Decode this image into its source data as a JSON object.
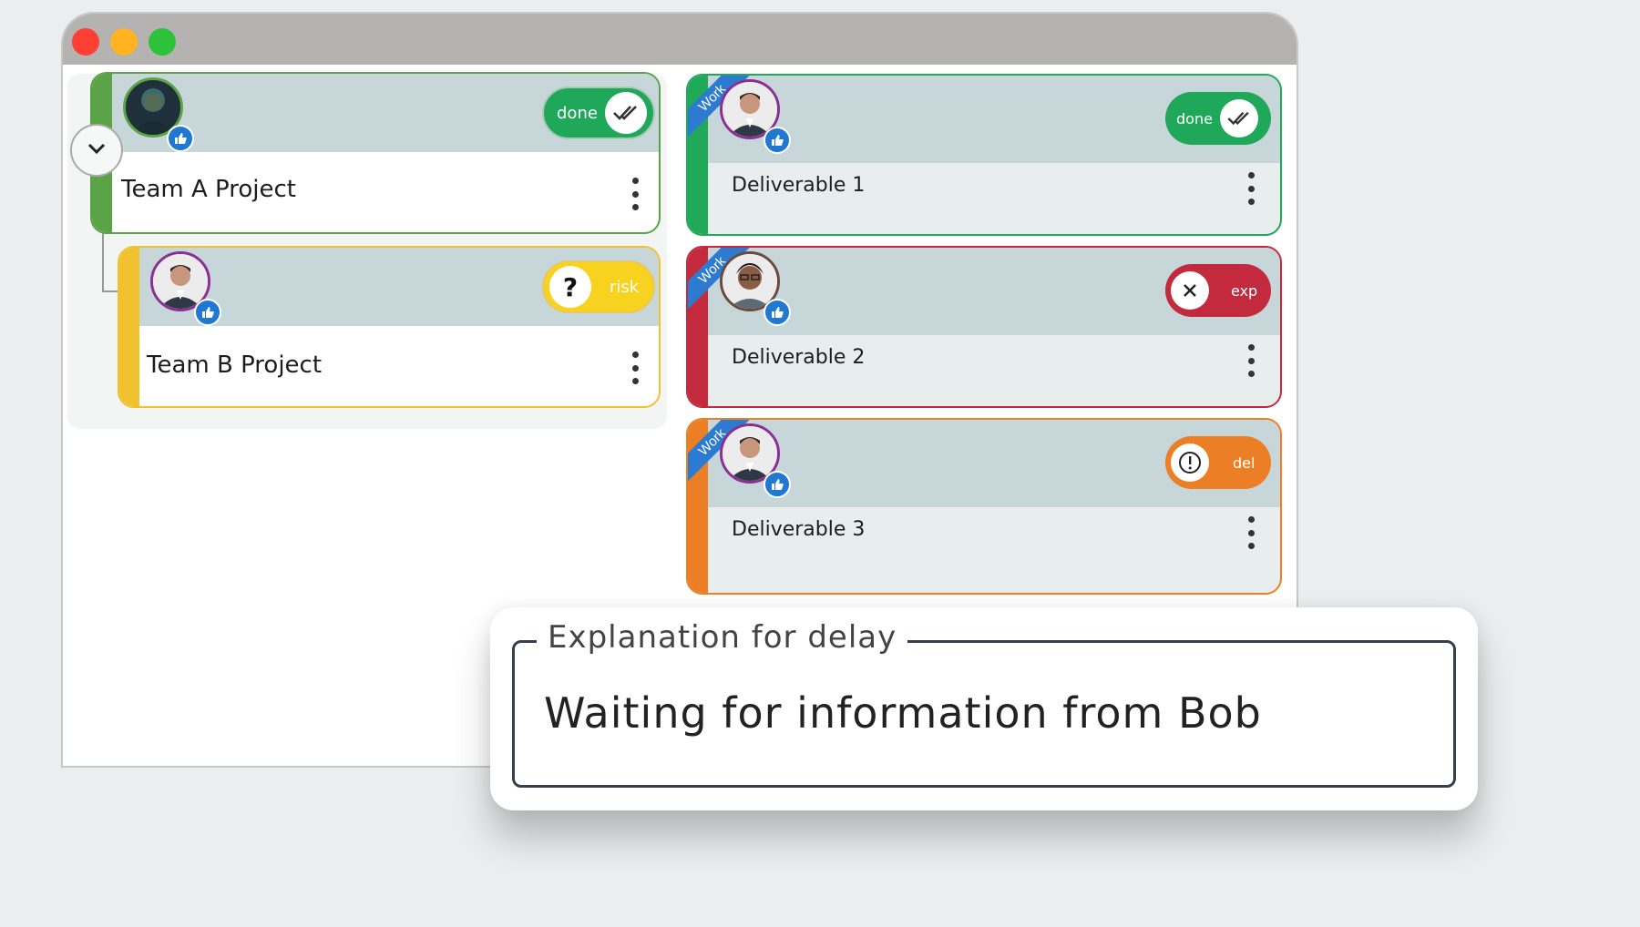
{
  "window": {
    "traffic_lights": {
      "close_color": "#ff4032",
      "minimize_color": "#ffb320",
      "maximize_color": "#2cc33b"
    }
  },
  "projects": [
    {
      "title": "Team A Project",
      "status": {
        "label": "done",
        "kind": "done",
        "color": "#1fa85a"
      },
      "accent": "#5aa447"
    },
    {
      "title": "Team B Project",
      "status": {
        "label": "risk",
        "kind": "risk",
        "color": "#f7d21e"
      },
      "accent": "#f1c22f"
    }
  ],
  "deliverables": [
    {
      "title": "Deliverable 1",
      "ribbon": "Work",
      "status": {
        "label": "done",
        "kind": "done",
        "color": "#1fa85a"
      },
      "accent": "#20a959"
    },
    {
      "title": "Deliverable 2",
      "ribbon": "Work",
      "status": {
        "label": "exp",
        "kind": "expired",
        "color": "#c42a3d"
      },
      "accent": "#c42a3d"
    },
    {
      "title": "Deliverable 3",
      "ribbon": "Work",
      "status": {
        "label": "del",
        "kind": "delayed",
        "color": "#ec7f25"
      },
      "accent": "#ec7f25"
    }
  ],
  "popup": {
    "legend": "Explanation for delay",
    "value": "Waiting for information from Bob"
  },
  "icons": {
    "expand": "chevron-down-icon",
    "like": "thumbs-up-icon",
    "done": "double-check-icon",
    "risk": "question-icon",
    "expired": "close-icon",
    "delayed": "exclamation-icon",
    "menu": "kebab-menu-icon"
  }
}
